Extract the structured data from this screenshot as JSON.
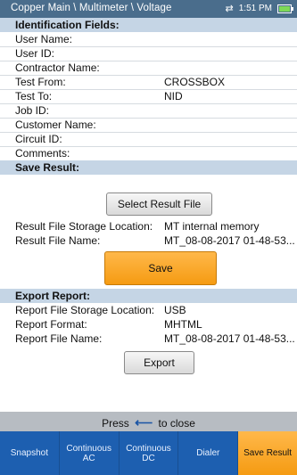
{
  "header": {
    "breadcrumb": "Copper Main \\ Multimeter \\ Voltage",
    "time": "1:51 PM",
    "usb_icon": "usb-icon",
    "battery_icon": "battery-icon"
  },
  "identification": {
    "title": "Identification Fields:",
    "fields": [
      {
        "label": "User Name:",
        "value": ""
      },
      {
        "label": "User ID:",
        "value": ""
      },
      {
        "label": "Contractor Name:",
        "value": ""
      },
      {
        "label": "Test From:",
        "value": "CROSSBOX"
      },
      {
        "label": "Test To:",
        "value": "NID"
      },
      {
        "label": "Job ID:",
        "value": ""
      },
      {
        "label": "Customer Name:",
        "value": ""
      },
      {
        "label": "Circuit ID:",
        "value": ""
      },
      {
        "label": "Comments:",
        "value": ""
      }
    ]
  },
  "save_result": {
    "title": "Save Result:",
    "select_button": "Select Result File",
    "storage_label": "Result File Storage Location:",
    "storage_value": "MT internal memory",
    "filename_label": "Result File Name:",
    "filename_value": "MT_08-08-2017 01-48-53...",
    "save_button": "Save"
  },
  "export_report": {
    "title": "Export Report:",
    "storage_label": "Report File Storage Location:",
    "storage_value": "USB",
    "format_label": "Report Format:",
    "format_value": "MHTML",
    "filename_label": "Report File Name:",
    "filename_value": "MT_08-08-2017 01-48-53...",
    "export_button": "Export"
  },
  "footer": {
    "press_pre": "Press",
    "press_post": "to close",
    "back_icon": "back-arrow-icon"
  },
  "tabs": [
    {
      "line1": "Snapshot",
      "line2": ""
    },
    {
      "line1": "Continuous",
      "line2": "AC"
    },
    {
      "line1": "Continuous",
      "line2": "DC"
    },
    {
      "line1": "Dialer",
      "line2": ""
    },
    {
      "line1": "Save Result",
      "line2": ""
    }
  ],
  "colors": {
    "header_bg": "#4a6d8c",
    "section_bg": "#c5d5e5",
    "tab_bg": "#1d5fb0",
    "accent_orange": "#f59b12"
  }
}
